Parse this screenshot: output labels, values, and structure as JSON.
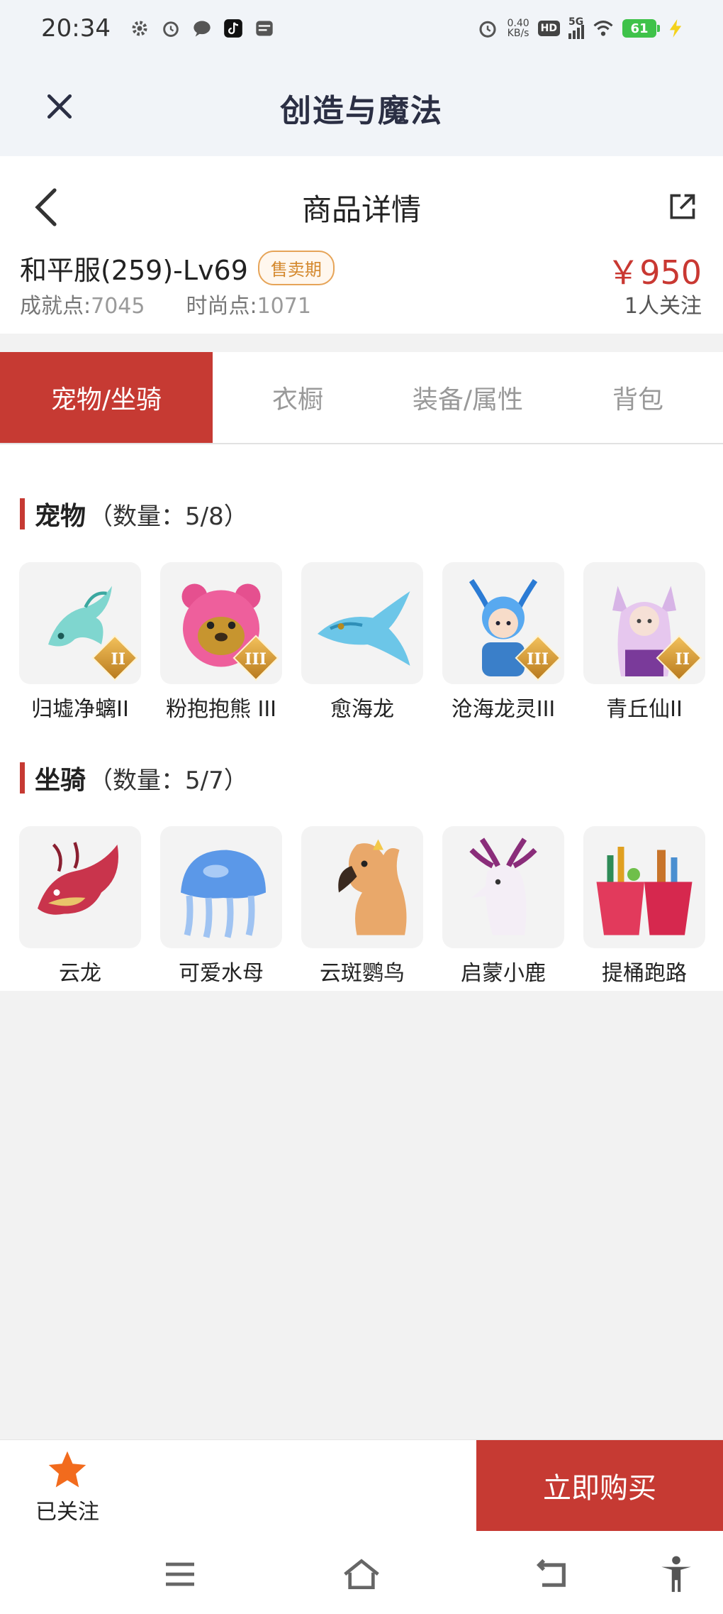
{
  "status_bar": {
    "time": "20:34",
    "net_speed_value": "0.40",
    "net_speed_unit": "KB/s",
    "hd_label": "HD",
    "signal_label": "5G",
    "battery_level": "61",
    "icons": [
      "gear-icon",
      "alarm-icon",
      "chat-icon",
      "tiktok-icon",
      "card-icon",
      "alarm-icon",
      "wifi-icon",
      "charging-icon"
    ]
  },
  "header": {
    "title": "创造与魔法"
  },
  "detail": {
    "page_title": "商品详情",
    "server_name": "和平服(259)-Lv69",
    "sale_badge": "售卖期",
    "achievement_label": "成就点:",
    "achievement_value": "7045",
    "fashion_label": "时尚点:",
    "fashion_value": "1071",
    "price": "￥950",
    "followers": "1人关注"
  },
  "tabs": [
    {
      "label": "宠物/坐骑",
      "active": true
    },
    {
      "label": "衣橱",
      "active": false
    },
    {
      "label": "装备/属性",
      "active": false
    },
    {
      "label": "背包",
      "active": false
    }
  ],
  "pets": {
    "title": "宠物",
    "count": "（数量：5/8）",
    "items": [
      {
        "name": "归墟净螭II",
        "tier": "II"
      },
      {
        "name": "粉抱抱熊 III",
        "tier": "III"
      },
      {
        "name": "愈海龙",
        "tier": ""
      },
      {
        "name": "沧海龙灵III",
        "tier": "III"
      },
      {
        "name": "青丘仙II",
        "tier": "II"
      }
    ]
  },
  "mounts": {
    "title": "坐骑",
    "count": "（数量：5/7）",
    "items": [
      {
        "name": "云龙"
      },
      {
        "name": "可爱水母"
      },
      {
        "name": "云斑鹦鸟"
      },
      {
        "name": "启蒙小鹿"
      },
      {
        "name": "提桶跑路"
      }
    ]
  },
  "bottom": {
    "follow_label": "已关注",
    "buy_label": "立即购买"
  },
  "colors": {
    "accent": "#c63a33",
    "price": "#c93832",
    "badge": "#d4892e",
    "star": "#f26b1d"
  }
}
